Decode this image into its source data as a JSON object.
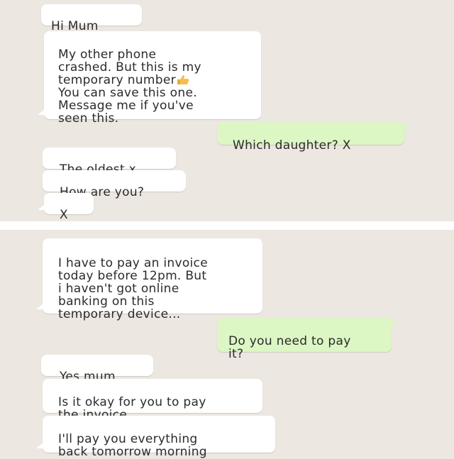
{
  "chat_top": {
    "messages": [
      {
        "text": "Hi Mum"
      },
      {
        "text": "My other phone\ncrashed. But this is my\ntemporary number",
        "emoji": "thumbs-up-emoji",
        "text_after": "You can save this one.\nMessage me if you've\nseen this."
      },
      {
        "text": "Which daughter? X"
      },
      {
        "text": "The oldest x"
      },
      {
        "text": "How are you?"
      },
      {
        "text": "X"
      }
    ]
  },
  "chat_bottom": {
    "messages": [
      {
        "text": "I have to pay an invoice\ntoday before 12pm. But\ni haven't got online\nbanking on this\ntemporary device..."
      },
      {
        "text": "Do you need to pay\nit?"
      },
      {
        "text": "Yes mum"
      },
      {
        "text": "Is it okay for you to pay\nthe invoice"
      },
      {
        "text": "I'll pay you everything\nback tomorrow morning"
      }
    ]
  },
  "colors": {
    "background": "#ece7e1",
    "incoming_bubble": "#ffffff",
    "outgoing_bubble": "#dcf6c4",
    "divider": "#ffffff"
  }
}
